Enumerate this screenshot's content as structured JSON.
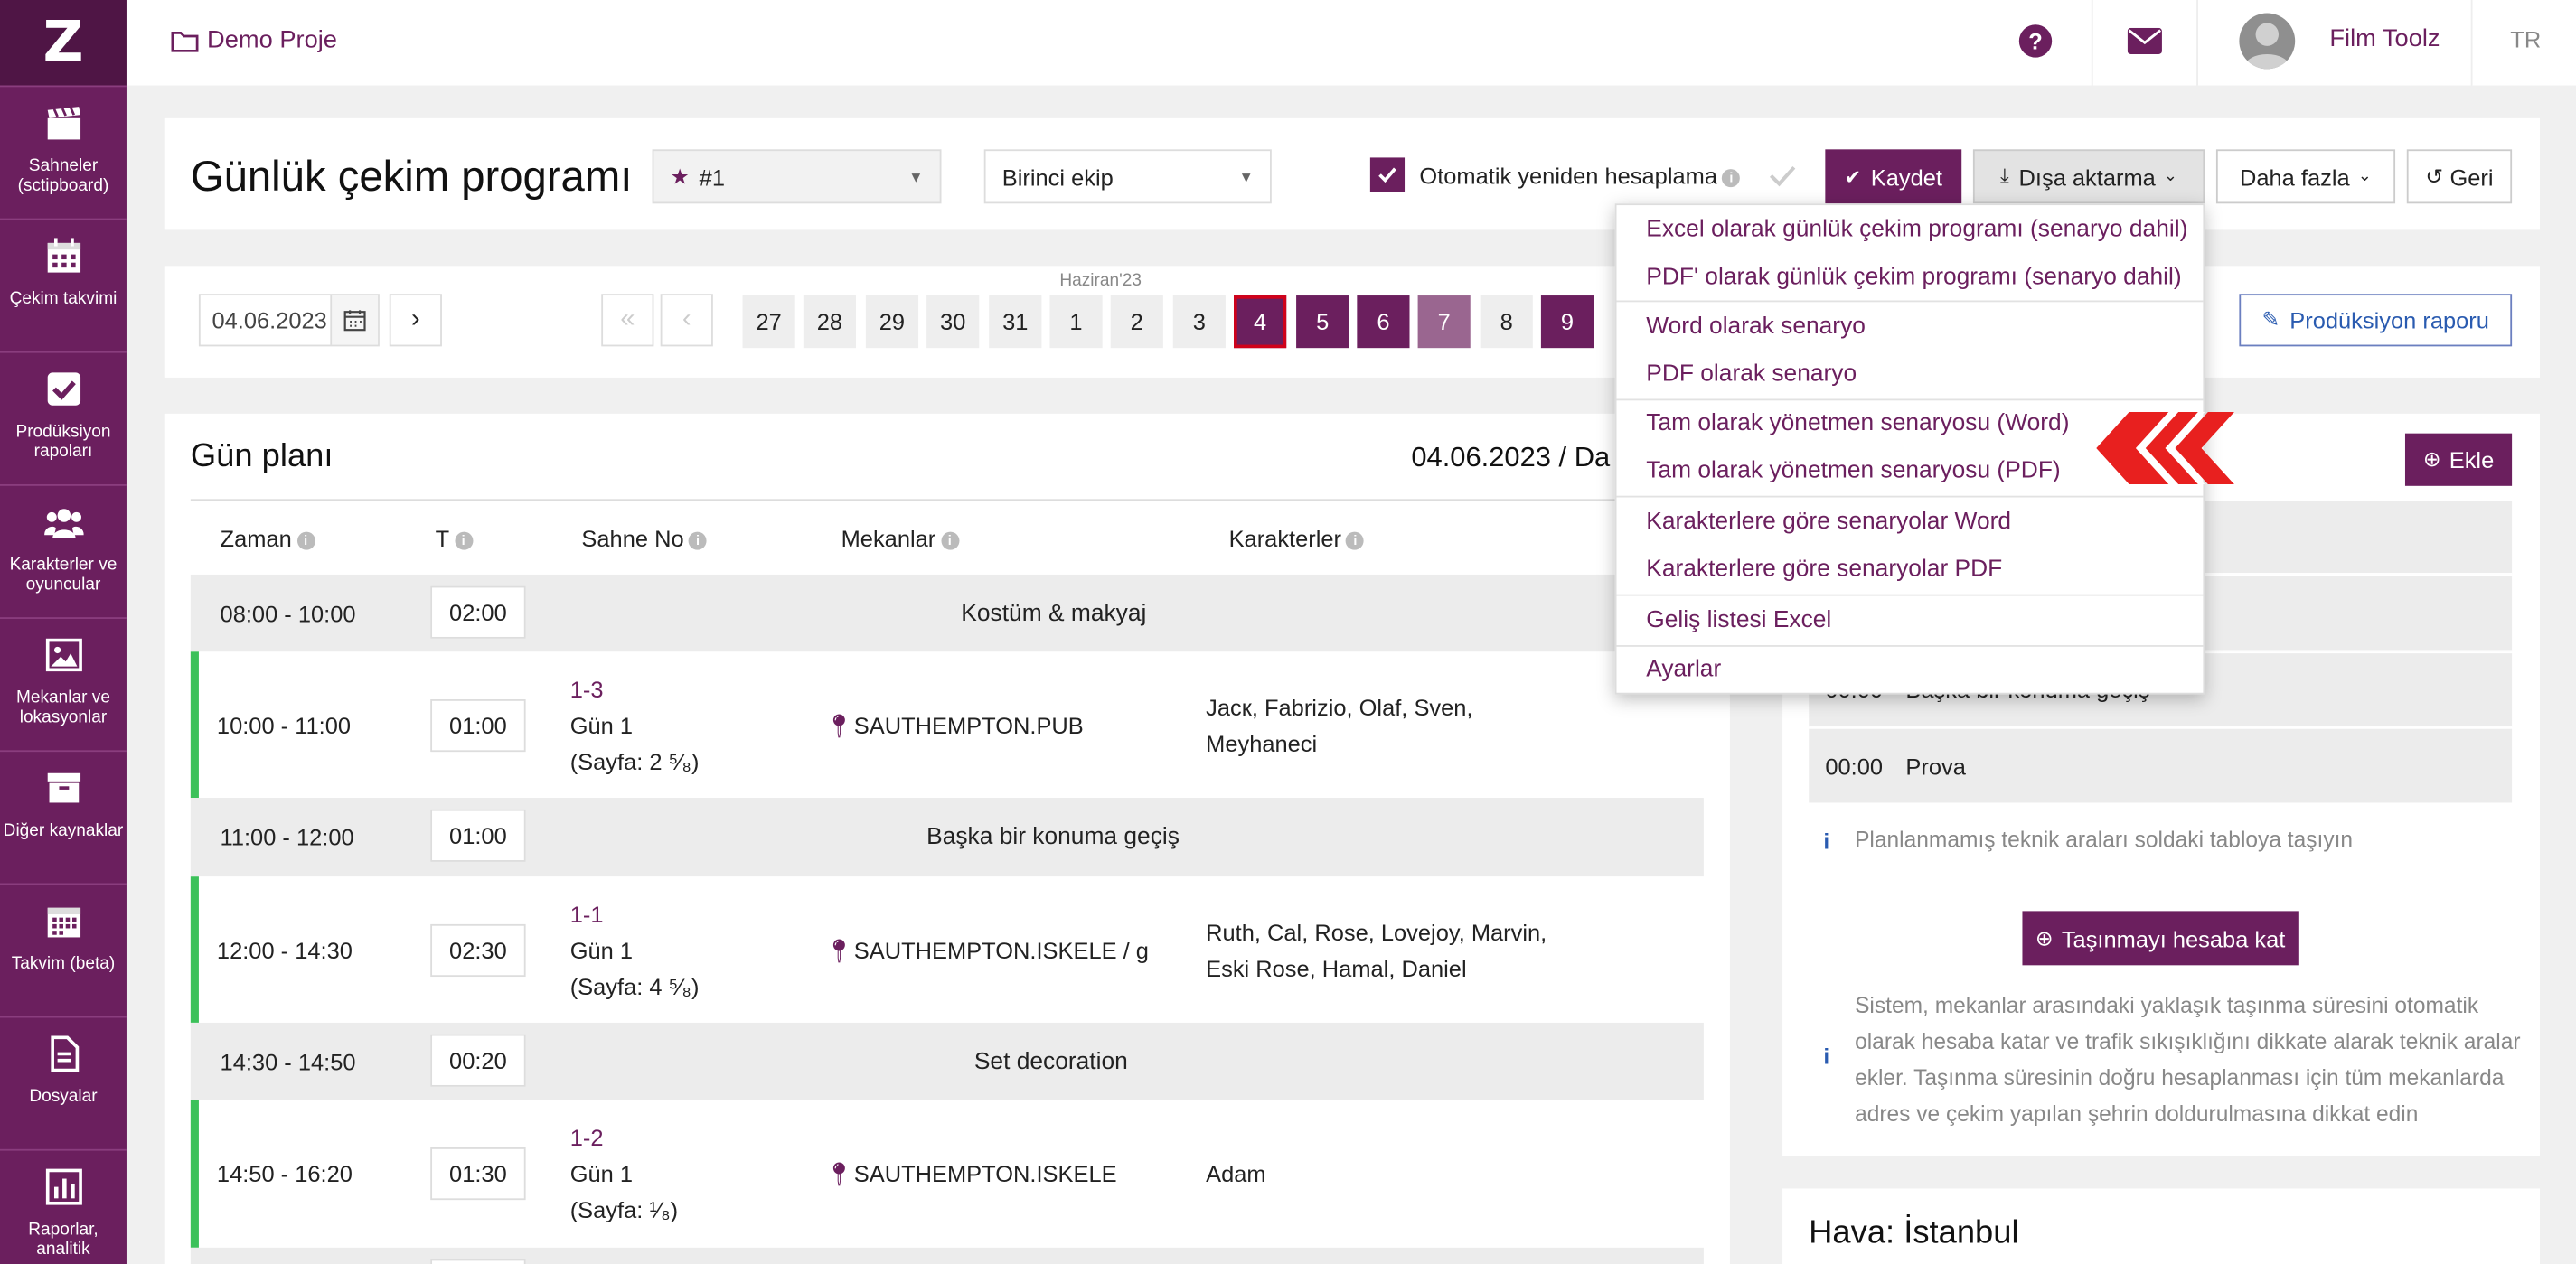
{
  "sidebar": {
    "logo": "Z",
    "items": [
      {
        "label": "Sahneler (sctipboard)",
        "icon": "clapperboard-icon"
      },
      {
        "label": "Çekim takvimi",
        "icon": "calendar-icon"
      },
      {
        "label": "Prodüksiyon rapoları",
        "icon": "checkbox-icon"
      },
      {
        "label": "Karakterler ve oyuncular",
        "icon": "users-icon"
      },
      {
        "label": "Mekanlar ve lokasyonlar",
        "icon": "image-icon"
      },
      {
        "label": "Diğer kaynaklar",
        "icon": "archive-icon"
      },
      {
        "label": "Takvim (beta)",
        "icon": "calendar-grid-icon"
      },
      {
        "label": "Dosyalar",
        "icon": "file-icon"
      },
      {
        "label": "Raporlar, analitik",
        "icon": "bar-chart-icon"
      }
    ]
  },
  "topbar": {
    "project": "Demo Proje",
    "user": "Film Toolz",
    "lang": "TR",
    "icons": [
      "folder-icon",
      "help-icon",
      "mail-icon",
      "avatar"
    ]
  },
  "header": {
    "title": "Günlük çekim programı",
    "version_select": "#1",
    "crew_select": "Birinci ekip",
    "auto_recalc_label": "Otomatik yeniden hesaplama",
    "auto_recalc_checked": true,
    "save": "Kaydet",
    "export": "Dışa aktarma",
    "more": "Daha fazla",
    "back": "Geri"
  },
  "datebar": {
    "date_value": "04.06.2023",
    "month_label": "Haziran'23",
    "days": [
      {
        "n": "27",
        "style": "plain"
      },
      {
        "n": "28",
        "style": "plain"
      },
      {
        "n": "29",
        "style": "plain"
      },
      {
        "n": "30",
        "style": "plain"
      },
      {
        "n": "31",
        "style": "plain"
      },
      {
        "n": "1",
        "style": "plain"
      },
      {
        "n": "2",
        "style": "plain"
      },
      {
        "n": "3",
        "style": "plain"
      },
      {
        "n": "4",
        "style": "selected"
      },
      {
        "n": "5",
        "style": "dark"
      },
      {
        "n": "6",
        "style": "dark"
      },
      {
        "n": "7",
        "style": "light"
      },
      {
        "n": "8",
        "style": "plain"
      },
      {
        "n": "9",
        "style": "dark"
      }
    ],
    "production_report": "Prodüksiyon raporu"
  },
  "dayplan": {
    "title": "Gün planı",
    "date_title": "04.06.2023 / Da",
    "columns": {
      "time": "Zaman",
      "t": "T",
      "scene": "Sahne No",
      "locations": "Mekanlar",
      "characters": "Karakterler"
    },
    "rows": [
      {
        "type": "break",
        "time": "08:00 - 10:00",
        "dur": "02:00",
        "label": "Kostüm & makyaj"
      },
      {
        "type": "scene",
        "time": "10:00 - 11:00",
        "dur": "01:00",
        "scene": "1-3",
        "day": "Gün 1",
        "page": "(Sayfa: 2 ⁵⁄₈)",
        "location": "SAUTHEMPTON.PUB",
        "chars1": "Jacк, Fabrizio, Olaf, Sven,",
        "chars2": "Meyhaneci"
      },
      {
        "type": "break",
        "time": "11:00 - 12:00",
        "dur": "01:00",
        "label": "Başka bir konuma geçiş"
      },
      {
        "type": "scene",
        "time": "12:00 - 14:30",
        "dur": "02:30",
        "scene": "1-1",
        "day": "Gün 1",
        "page": "(Sayfa: 4 ⁵⁄₈)",
        "location": "SAUTHEMPTON.ISKELE / g",
        "chars1": "Ruth, Cal, Rose, Lovejoy, Marvin,",
        "chars2": "Eski Rose, Hamal, Daniel"
      },
      {
        "type": "break",
        "time": "14:30 - 14:50",
        "dur": "00:20",
        "label": "Set decoration"
      },
      {
        "type": "scene",
        "time": "14:50 - 16:20",
        "dur": "01:30",
        "scene": "1-2",
        "day": "Gün 1",
        "page": "(Sayfa: ¹⁄₈)",
        "location": "SAUTHEMPTON.ISKELE",
        "chars1": "Adam",
        "chars2": ""
      }
    ]
  },
  "export_menu": {
    "items": [
      "Excel olarak günlük çekim programı (senaryo dahil)",
      "PDF' olarak günlük çekim programı (senaryo dahil)",
      "Word olarak senaryo",
      "PDF olarak senaryo",
      "Tam olarak yönetmen senaryosu (Word)",
      "Tam olarak yönetmen senaryosu (PDF)",
      "Karakterlere göre senaryolar Word",
      "Karakterlere göre senaryolar PDF",
      "Geliş listesi Excel",
      "Ayarlar"
    ]
  },
  "right_panel": {
    "add": "Ekle",
    "partial_row": "Başka bir konuma geçiş",
    "partial_time": "00:00",
    "prova_time": "00:00",
    "prova_label": "Prova",
    "hint1": "Planlanmamış teknik araları soldaki tabloya taşıyın",
    "move_btn": "Taşınmayı hesaba kat",
    "hint2_lines": [
      "Sistem, mekanlar arasındaki yaklaşık taşınma süresini otomatik",
      "olarak hesaba katar ve trafik sıkışıklığını dikkate alarak teknik aralar",
      "ekler. Taşınma süresinin doğru hesaplanması için tüm mekanlarda",
      "adres ve çekim yapılan şehrin doldurulmasına dikkat edin"
    ],
    "weather_title": "Hava: İstanbul"
  },
  "colors": {
    "brand": "#6b1f5e",
    "green": "#3cc15a",
    "red_arrow": "#e8201f"
  }
}
